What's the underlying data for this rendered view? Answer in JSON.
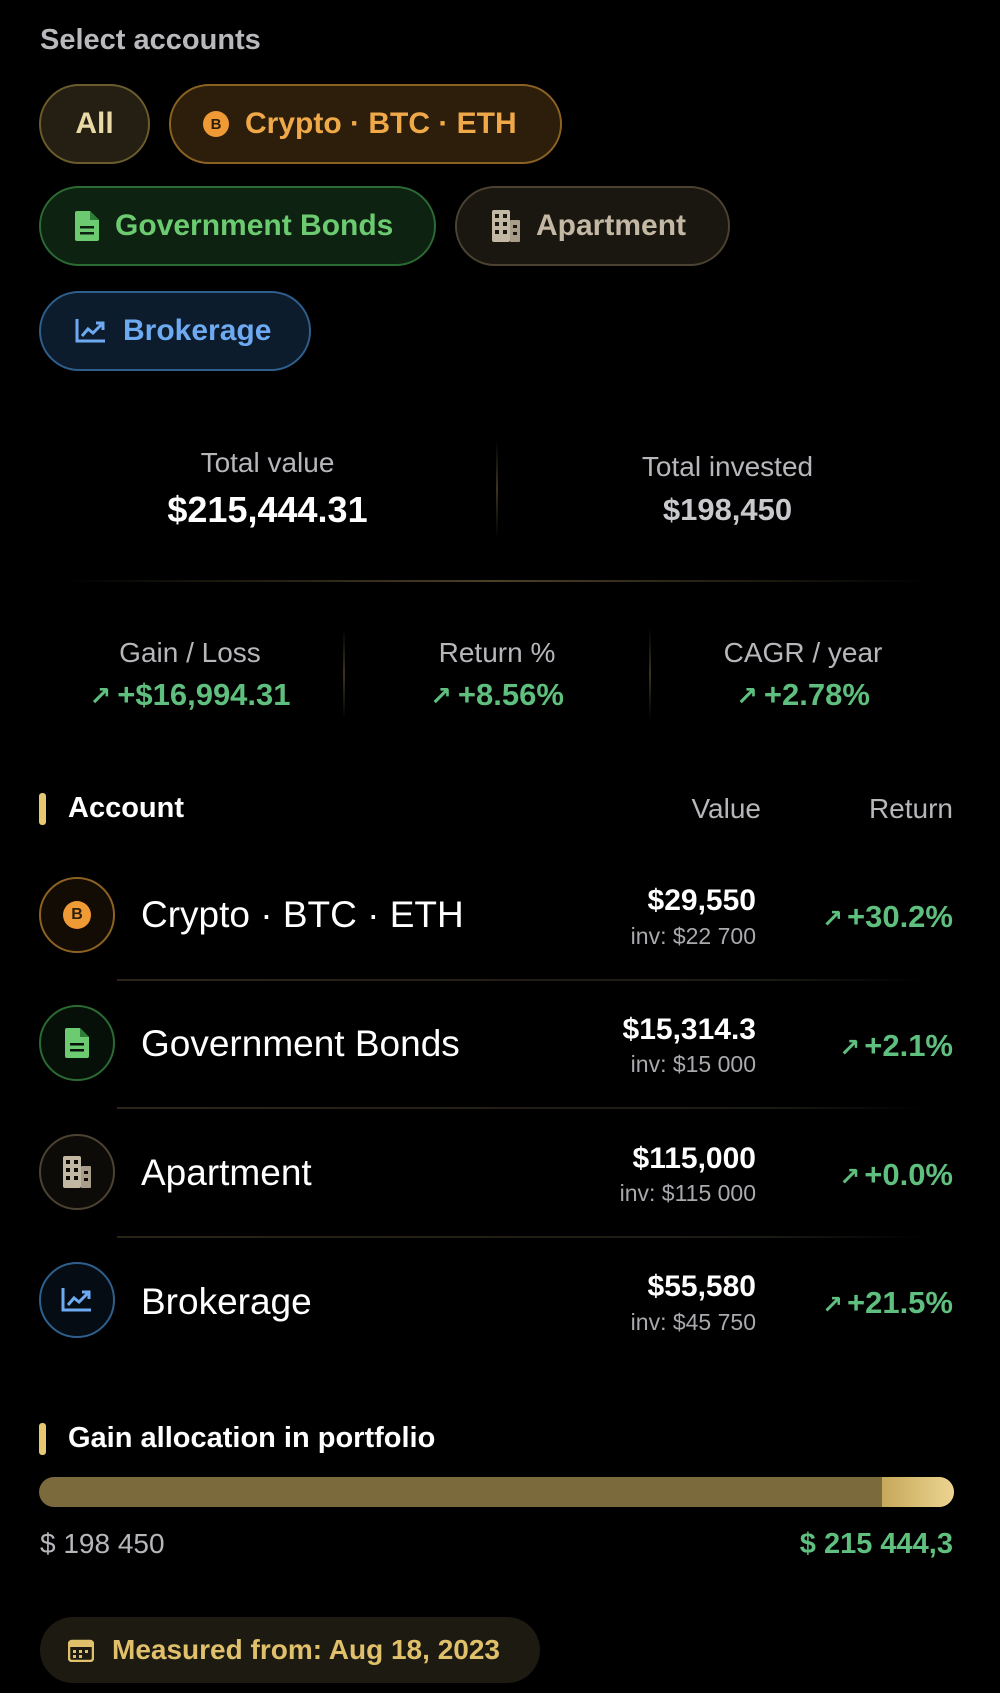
{
  "select_label": "Select accounts",
  "chips": {
    "all": "All",
    "crypto": "Crypto · BTC · ETH",
    "bonds": "Government Bonds",
    "apartment": "Apartment",
    "brokerage": "Brokerage"
  },
  "coin_letter": "B",
  "summary": {
    "total_value_label": "Total value",
    "total_value": "$215,444.31",
    "total_invested_label": "Total invested",
    "total_invested": "$198,450"
  },
  "metrics": {
    "gain_label": "Gain / Loss",
    "gain_value": "+$16,994.31",
    "return_label": "Return %",
    "return_value": "+8.56%",
    "cagr_label": "CAGR / year",
    "cagr_value": "+2.78%",
    "trend_glyph": "↗"
  },
  "accounts": {
    "heading": "Account",
    "value_header": "Value",
    "return_header": "Return",
    "rows": [
      {
        "name": "Crypto · BTC · ETH",
        "value": "$29,550",
        "invested": "inv: $22 700",
        "return": "+30.2%"
      },
      {
        "name": "Government Bonds",
        "value": "$15,314.3",
        "invested": "inv: $15 000",
        "return": "+2.1%"
      },
      {
        "name": "Apartment",
        "value": "$115,000",
        "invested": "inv: $115 000",
        "return": "+0.0%"
      },
      {
        "name": "Brokerage",
        "value": "$55,580",
        "invested": "inv: $45 750",
        "return": "+21.5%"
      }
    ]
  },
  "allocation": {
    "heading": "Gain allocation in portfolio",
    "invested_label": "$ 198 450",
    "total_label": "$ 215 444,3",
    "invested_amount": 198450,
    "total_amount": 215444.31
  },
  "measured": "Measured from: Aug 18, 2023",
  "colors": {
    "accent": "#e6c872",
    "crypto": "#f09a35",
    "bonds": "#6ccb70",
    "apartment": "#c3b8a4",
    "brokerage": "#6eaaf1",
    "positive": "#5fbf7e"
  }
}
